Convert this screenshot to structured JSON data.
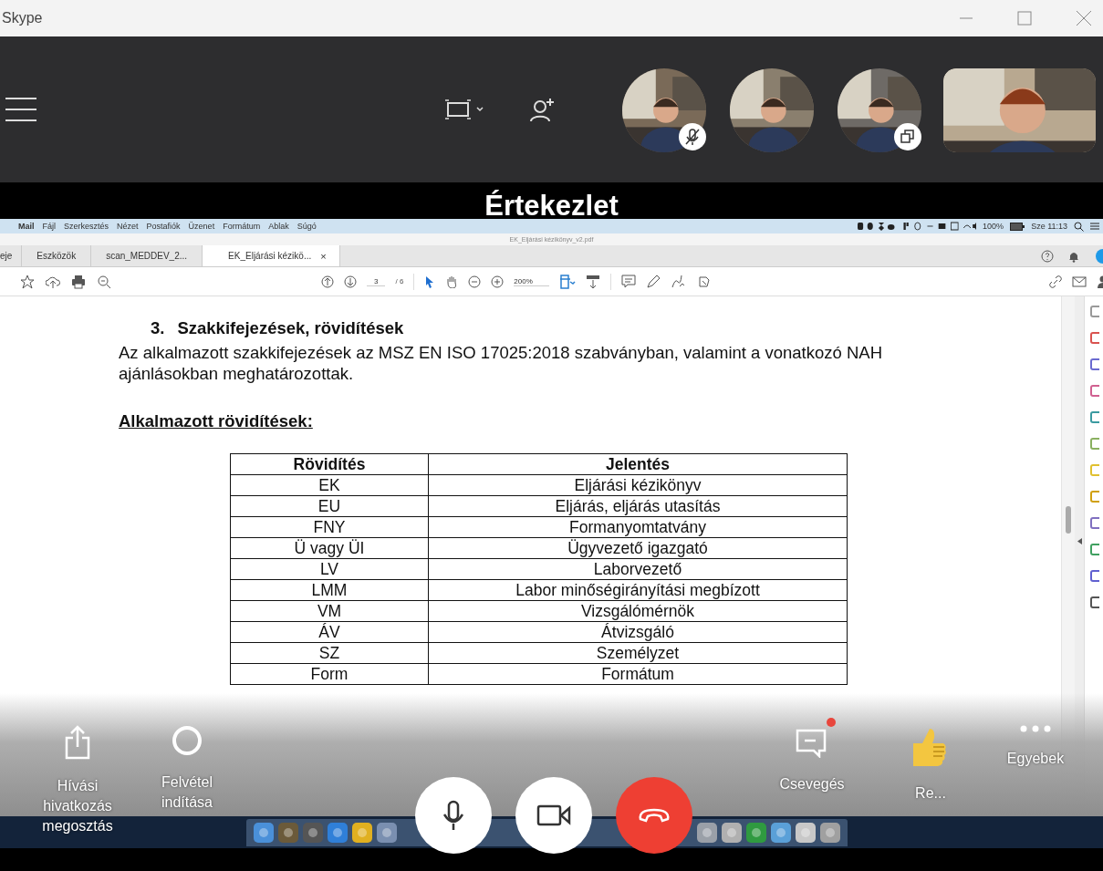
{
  "app": {
    "title": "Skype"
  },
  "call": {
    "participants": [
      {
        "kind": "circle",
        "muted": true,
        "popout": false
      },
      {
        "kind": "circle",
        "muted": false,
        "popout": false
      },
      {
        "kind": "circle",
        "muted": false,
        "popout": true
      },
      {
        "kind": "tile",
        "muted": false,
        "popout": false
      }
    ]
  },
  "meeting": {
    "title": "Értekezlet"
  },
  "shared_screen": {
    "menu_bar": {
      "items": [
        {
          "label": "Mail",
          "kind": "app"
        },
        {
          "label": "Fájl",
          "kind": "menu"
        },
        {
          "label": "Szerkesztés",
          "kind": "menu"
        },
        {
          "label": "Nézet",
          "kind": "menu"
        },
        {
          "label": "Postafiók",
          "kind": "menu"
        },
        {
          "label": "Üzenet",
          "kind": "menu"
        },
        {
          "label": "Formátum",
          "kind": "menu"
        },
        {
          "label": "Ablak",
          "kind": "menu"
        },
        {
          "label": "Súgó",
          "kind": "menu"
        }
      ],
      "battery": "100%",
      "clock": "Sze 11:13"
    },
    "pdf_title": "EK_Eljárási kézikönyv_v2.pdf",
    "tabs": [
      {
        "label": "eje",
        "selected": false
      },
      {
        "label": "Eszközök",
        "selected": false
      },
      {
        "label": "scan_MEDDEV_2...",
        "selected": false
      },
      {
        "label": "EK_Eljárási kézikö...",
        "selected": true,
        "close": "×"
      }
    ],
    "toolbar": {
      "page": "3",
      "page_count": "/ 6",
      "zoom": "200%"
    },
    "document": {
      "heading_number": "3.",
      "heading": "Szakkifejezések, rövidítések",
      "paragraph": "Az alkalmazott szakkifejezések az MSZ EN ISO 17025:2018 szabványban, valamint a vonatkozó NAH ajánlásokban meghatározottak.",
      "subheading": "Alkalmazott rövidítések:",
      "table": {
        "columns": [
          "Rövidítés",
          "Jelentés"
        ],
        "rows": [
          [
            "EK",
            "Eljárási kézikönyv"
          ],
          [
            "EU",
            "Eljárás, eljárás utasítás"
          ],
          [
            "FNY",
            "Formanyomtatvány"
          ],
          [
            "Ü vagy ÜI",
            "Ügyvezető igazgató"
          ],
          [
            "LV",
            "Laborvezető"
          ],
          [
            "LMM",
            "Labor minőségirányítási megbízott"
          ],
          [
            "VM",
            "Vizsgálómérnök"
          ],
          [
            "ÁV",
            "Átvizsgáló"
          ],
          [
            "SZ",
            "Személyzet"
          ],
          [
            "Form",
            "Formátum"
          ]
        ]
      }
    }
  },
  "controls": [
    {
      "kind": "share",
      "label": "Hívási hivatkozás megosztás"
    },
    {
      "kind": "record",
      "label": "Felvétel indítása"
    },
    {
      "kind": "chat",
      "label": "Csevegés",
      "unread": true
    },
    {
      "kind": "react",
      "label": "Re..."
    },
    {
      "kind": "more",
      "label": "Egyebek"
    }
  ],
  "call_buttons": [
    {
      "kind": "mic"
    },
    {
      "kind": "video"
    },
    {
      "kind": "hangup"
    }
  ]
}
